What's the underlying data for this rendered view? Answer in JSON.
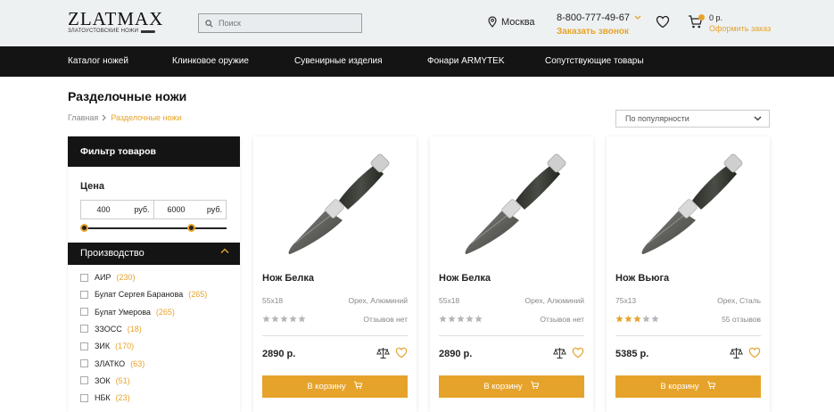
{
  "header": {
    "logo_main": "ZLATMAX",
    "logo_sub": "ЗЛАТОУСТОВСКИЕ НОЖИ",
    "search_placeholder": "Поиск",
    "city": "Москва",
    "phone": "8-800-777-49-67",
    "callback": "Заказать звонок",
    "cart_sum": "0 р.",
    "cart_order": "Оформить заказ",
    "accent": "#e6a32b"
  },
  "nav": [
    "Каталог ножей",
    "Клинковое оружие",
    "Сувенирные изделия",
    "Фонари ARMYTEK",
    "Сопутствующие товары"
  ],
  "page": {
    "title": "Разделочные ножи",
    "breadcrumb_home": "Главная",
    "breadcrumb_current": "Разделочные ножи",
    "sort": "По популярности"
  },
  "filter": {
    "title": "Фильтр товаров",
    "price_label": "Цена",
    "price_min": "400",
    "price_max": "6000",
    "currency": "руб.",
    "price_range_fraction": [
      0.0,
      0.75
    ],
    "producers_title": "Производство",
    "producers": [
      {
        "name": "АИР",
        "count": "(230)"
      },
      {
        "name": "Булат Сергея Баранова",
        "count": "(265)"
      },
      {
        "name": "Булат Умерова",
        "count": "(265)"
      },
      {
        "name": "ЗЗОСС",
        "count": "(18)"
      },
      {
        "name": "ЗИК",
        "count": "(170)"
      },
      {
        "name": "ЗЛАТКО",
        "count": "(63)"
      },
      {
        "name": "ЗОК",
        "count": "(51)"
      },
      {
        "name": "НБК",
        "count": "(23)"
      }
    ]
  },
  "products": [
    {
      "name": "Нож Белка",
      "size": "55x18",
      "material": "Орех, Алюминий",
      "rating": 0,
      "reviews": "Отзывов нет",
      "price": "2890 р.",
      "buy": "В корзину"
    },
    {
      "name": "Нож Белка",
      "size": "55x18",
      "material": "Орех, Алюминий",
      "rating": 0,
      "reviews": "Отзывов нет",
      "price": "2890 р.",
      "buy": "В корзину"
    },
    {
      "name": "Нож Вьюга",
      "size": "75x13",
      "material": "Орех, Сталь",
      "rating": 3,
      "reviews": "55 отзывов",
      "price": "5385 р.",
      "buy": "В корзину"
    }
  ]
}
